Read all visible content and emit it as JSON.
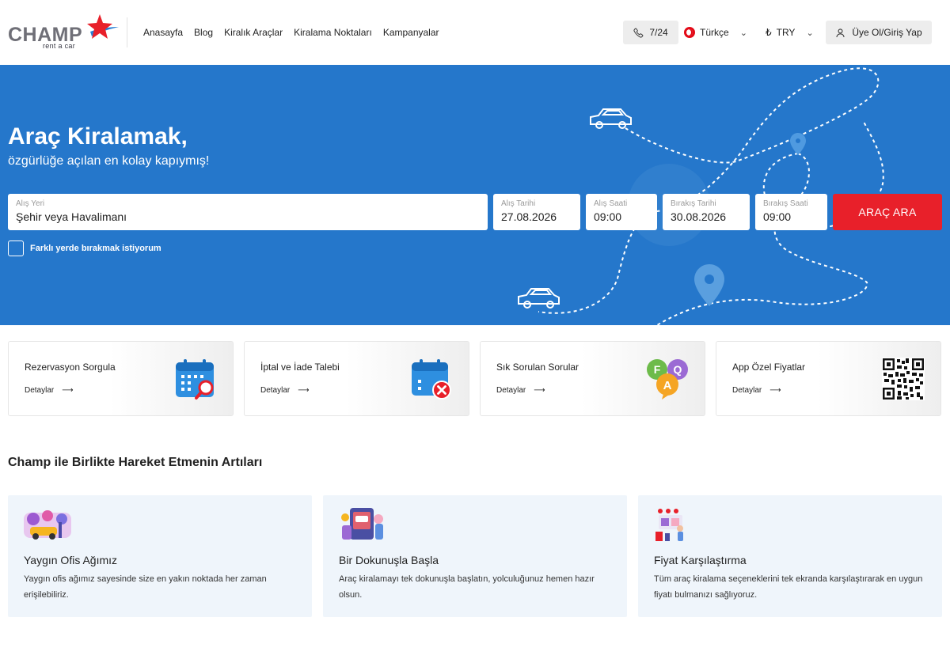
{
  "header": {
    "logo": {
      "word": "CHAMP",
      "sub": "rent a car"
    },
    "nav": [
      "Anasayfa",
      "Blog",
      "Kiralık Araçlar",
      "Kiralama Noktaları",
      "Kampanyalar"
    ],
    "phone_label": "7/24",
    "language": "Türkçe",
    "currency_symbol": "₺",
    "currency": "TRY",
    "login_label": "Üye Ol/Giriş Yap"
  },
  "hero": {
    "title": "Araç Kiralamak,",
    "subtitle": "özgürlüğe açılan en kolay kapıymış!",
    "pickup_place": {
      "label": "Alış Yeri",
      "value": "Şehir veya Havalimanı"
    },
    "pickup_date": {
      "label": "Alış Tarihi",
      "value": "27.08.2026"
    },
    "pickup_time": {
      "label": "Alış Saati",
      "value": "09:00"
    },
    "return_date": {
      "label": "Bırakış Tarihi",
      "value": "30.08.2026"
    },
    "return_time": {
      "label": "Bırakış Saati",
      "value": "09:00"
    },
    "search_label": "ARAÇ ARA",
    "different_return_label": "Farklı yerde bırakmak istiyorum",
    "different_return_checked": false
  },
  "action_cards": [
    {
      "title": "Rezervasyon Sorgula",
      "link": "Detaylar",
      "icon": "calendar-search-icon"
    },
    {
      "title": "İptal ve İade Talebi",
      "link": "Detaylar",
      "icon": "calendar-cancel-icon"
    },
    {
      "title": "Sık Sorulan Sorular",
      "link": "Detaylar",
      "icon": "faq-icon"
    },
    {
      "title": "App Özel Fiyatlar",
      "link": "Detaylar",
      "icon": "qr-code-icon"
    }
  ],
  "features": {
    "title": "Champ ile Birlikte Hareket Etmenin Artıları",
    "items": [
      {
        "title": "Yaygın Ofis Ağımız",
        "desc": "Yaygın ofis ağımız sayesinde size en yakın noktada her zaman erişilebiliriz."
      },
      {
        "title": "Bir Dokunuşla Başla",
        "desc": "Araç kiralamayı tek dokunuşla başlatın, yolculuğunuz hemen hazır olsun."
      },
      {
        "title": "Fiyat Karşılaştırma",
        "desc": "Tüm araç kiralama seçeneklerini tek ekranda karşılaştırarak en uygun fiyatı bulmanızı sağlıyoruz."
      }
    ]
  },
  "colors": {
    "brand_blue": "#2577cb",
    "brand_red": "#e8202a",
    "feature_bg": "#eff5fb"
  }
}
